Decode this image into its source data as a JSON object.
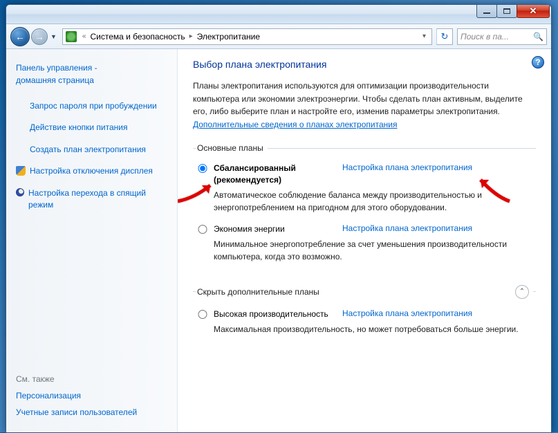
{
  "titlebar": {
    "close_glyph": "✕"
  },
  "nav": {
    "breadcrumb": {
      "item1": "Система и безопасность",
      "item2": "Электропитание"
    },
    "search_placeholder": "Поиск в па...",
    "chevron": "«"
  },
  "sidebar": {
    "home_line1": "Панель управления -",
    "home_line2": "домашняя страница",
    "items": [
      {
        "label": "Запрос пароля при пробуждении"
      },
      {
        "label": "Действие кнопки питания"
      },
      {
        "label": "Создать план электропитания"
      },
      {
        "label": "Настройка отключения дисплея",
        "icon": "shield"
      },
      {
        "label": "Настройка перехода в спящий режим",
        "icon": "moon"
      }
    ],
    "see_also_title": "См. также",
    "see_also": [
      {
        "label": "Персонализация"
      },
      {
        "label": "Учетные записи пользователей"
      }
    ]
  },
  "main": {
    "heading": "Выбор плана электропитания",
    "intro_text": "Планы электропитания используются для оптимизации производительности компьютера или экономии электроэнергии. Чтобы сделать план активным, выделите его, либо выберите план и настройте его, изменив параметры электропитания. ",
    "intro_link": "Дополнительные сведения о планах электропитания",
    "group1_legend": "Основные планы",
    "group2_legend": "Скрыть дополнительные планы",
    "plan_settings_link": "Настройка плана электропитания",
    "plans": {
      "balanced": {
        "name": "Сбалансированный (рекомендуется)",
        "desc": "Автоматическое соблюдение баланса между производительностью и энергопотреблением на пригодном для этого оборудовании."
      },
      "saver": {
        "name": "Экономия энергии",
        "desc": "Минимальное энергопотребление за счет уменьшения производительности компьютера, когда это возможно."
      },
      "high": {
        "name": "Высокая производительность",
        "desc": "Максимальная производительность, но может потребоваться больше энергии."
      }
    }
  }
}
